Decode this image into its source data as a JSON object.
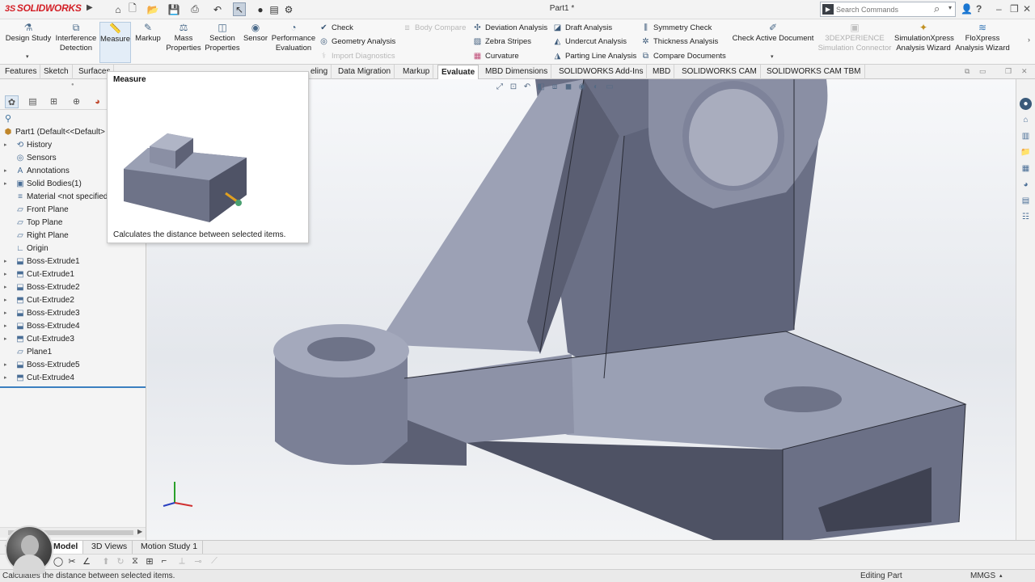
{
  "app": {
    "logo_text": "SOLIDWORKS",
    "logo_prefix": "3S",
    "document_title": "Part1 *"
  },
  "titlebar": {
    "search_placeholder": "Search Commands",
    "help_label": "?",
    "quick_access_icons": [
      "home-icon",
      "new-document-icon",
      "open-folder-icon",
      "save-icon",
      "print-icon",
      "undo-icon",
      "select-arrow-icon",
      "rebuild-icon",
      "file-properties-icon",
      "options-gear-icon"
    ],
    "window_controls": [
      "minimize-icon",
      "restore-icon",
      "close-icon"
    ]
  },
  "ribbon": {
    "large_buttons": [
      {
        "name": "design-study",
        "label": "Design Study",
        "icon": "design-study-icon"
      },
      {
        "name": "interference-detection",
        "label": "Interference Detection",
        "icon": "interference-icon"
      },
      {
        "name": "measure",
        "label": "Measure",
        "icon": "measure-ruler-icon"
      },
      {
        "name": "markup",
        "label": "Markup",
        "icon": "markup-pen-icon"
      },
      {
        "name": "mass-properties",
        "label": "Mass Properties",
        "icon": "mass-properties-icon"
      },
      {
        "name": "section-properties",
        "label": "Section Properties",
        "icon": "section-properties-icon"
      },
      {
        "name": "sensor",
        "label": "Sensor",
        "icon": "sensor-icon"
      },
      {
        "name": "performance-evaluation",
        "label": "Performance Evaluation",
        "icon": "performance-icon"
      }
    ],
    "small_col1": [
      {
        "name": "check",
        "label": "Check",
        "enabled": true
      },
      {
        "name": "geometry-analysis",
        "label": "Geometry Analysis",
        "enabled": true
      },
      {
        "name": "import-diagnostics",
        "label": "Import Diagnostics",
        "enabled": false
      }
    ],
    "body_compare": {
      "label": "Body Compare",
      "enabled": false
    },
    "small_col2": [
      {
        "name": "deviation-analysis",
        "label": "Deviation Analysis"
      },
      {
        "name": "zebra-stripes",
        "label": "Zebra Stripes"
      },
      {
        "name": "curvature",
        "label": "Curvature"
      }
    ],
    "small_col3": [
      {
        "name": "draft-analysis",
        "label": "Draft Analysis"
      },
      {
        "name": "undercut-analysis",
        "label": "Undercut Analysis"
      },
      {
        "name": "parting-line-analysis",
        "label": "Parting Line Analysis"
      }
    ],
    "small_col4": [
      {
        "name": "symmetry-check",
        "label": "Symmetry Check"
      },
      {
        "name": "thickness-analysis",
        "label": "Thickness Analysis"
      },
      {
        "name": "compare-documents",
        "label": "Compare Documents"
      }
    ],
    "check_active_document": "Check Active Document",
    "experience_connector": "3DEXPERIENCE Simulation Connector",
    "simulationxpress": "SimulationXpress Analysis Wizard",
    "floxpress": "FloXpress Analysis Wizard"
  },
  "tabs": [
    {
      "label": "Features",
      "active": false
    },
    {
      "label": "Sketch",
      "active": false
    },
    {
      "label": "Surfaces",
      "active": false
    },
    {
      "label": "Data Migration",
      "active": false
    },
    {
      "label": "Markup",
      "active": false
    },
    {
      "label": "Evaluate",
      "active": true
    },
    {
      "label": "MBD Dimensions",
      "active": false
    },
    {
      "label": "SOLIDWORKS Add-Ins",
      "active": false
    },
    {
      "label": "MBD",
      "active": false
    },
    {
      "label": "SOLIDWORKS CAM",
      "active": false
    },
    {
      "label": "SOLIDWORKS CAM TBM",
      "active": false
    }
  ],
  "tab_fragment": "eling",
  "feature_tree": {
    "root": "Part1  (Default<<Default>",
    "nodes": [
      {
        "label": "History",
        "expandable": true,
        "icon": "history-icon"
      },
      {
        "label": "Sensors",
        "expandable": false,
        "icon": "sensors-icon"
      },
      {
        "label": "Annotations",
        "expandable": true,
        "icon": "annotations-icon"
      },
      {
        "label": "Solid Bodies(1)",
        "expandable": true,
        "icon": "solid-bodies-icon"
      },
      {
        "label": "Material <not specified>",
        "expandable": false,
        "icon": "material-icon"
      },
      {
        "label": "Front Plane",
        "expandable": false,
        "icon": "plane-icon"
      },
      {
        "label": "Top Plane",
        "expandable": false,
        "icon": "plane-icon"
      },
      {
        "label": "Right Plane",
        "expandable": false,
        "icon": "plane-icon"
      },
      {
        "label": "Origin",
        "expandable": false,
        "icon": "origin-icon"
      },
      {
        "label": "Boss-Extrude1",
        "expandable": true,
        "icon": "boss-extrude-icon"
      },
      {
        "label": "Cut-Extrude1",
        "expandable": true,
        "icon": "cut-extrude-icon"
      },
      {
        "label": "Boss-Extrude2",
        "expandable": true,
        "icon": "boss-extrude-icon"
      },
      {
        "label": "Cut-Extrude2",
        "expandable": true,
        "icon": "cut-extrude-icon"
      },
      {
        "label": "Boss-Extrude3",
        "expandable": true,
        "icon": "boss-extrude-icon"
      },
      {
        "label": "Boss-Extrude4",
        "expandable": true,
        "icon": "boss-extrude-icon"
      },
      {
        "label": "Cut-Extrude3",
        "expandable": true,
        "icon": "cut-extrude-icon"
      },
      {
        "label": "Plane1",
        "expandable": false,
        "icon": "plane-icon"
      },
      {
        "label": "Boss-Extrude5",
        "expandable": true,
        "icon": "boss-extrude-icon"
      },
      {
        "label": "Cut-Extrude4",
        "expandable": true,
        "icon": "cut-extrude-icon"
      }
    ]
  },
  "tooltip": {
    "title": "Measure",
    "description": "Calculates the distance between selected items."
  },
  "bottom_tabs": [
    {
      "label": "Model",
      "active": true
    },
    {
      "label": "3D Views",
      "active": false
    },
    {
      "label": "Motion Study 1",
      "active": false
    }
  ],
  "statusbar": {
    "message": "Calculates the distance between selected items.",
    "mode": "Editing Part",
    "units": "MMGS"
  },
  "colors": {
    "logo_red": "#d31f26",
    "model_face_light": "#9aa0b4",
    "model_face_mid": "#6b7086",
    "model_face_dark": "#4a4d5c",
    "selection_blue": "#3c7fc0"
  }
}
